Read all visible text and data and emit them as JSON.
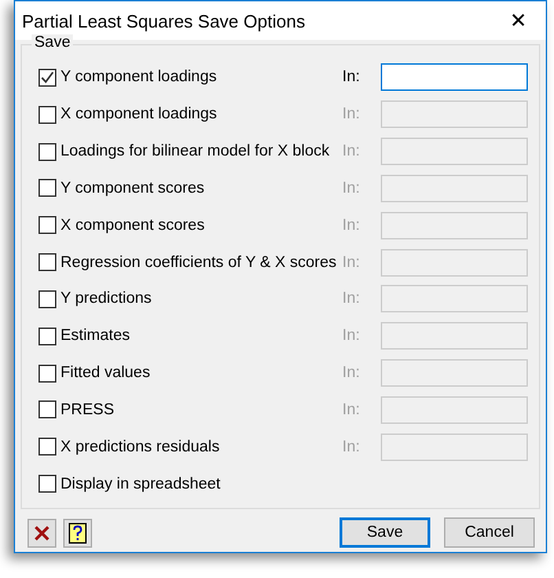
{
  "window": {
    "title": "Partial Least Squares Save Options",
    "close": "✕"
  },
  "group": {
    "title": "Save"
  },
  "rows": [
    {
      "kind": "field",
      "label": "Y component loadings",
      "checked": true,
      "in_label": "In:",
      "disabled": false
    },
    {
      "kind": "field",
      "label": "X component loadings",
      "checked": false,
      "in_label": "In:",
      "disabled": true
    },
    {
      "kind": "field",
      "label": "Loadings for bilinear model for X block",
      "checked": false,
      "in_label": "In:",
      "disabled": true
    },
    {
      "kind": "field",
      "label": "Y component scores",
      "checked": false,
      "in_label": "In:",
      "disabled": true
    },
    {
      "kind": "field",
      "label": "X component scores",
      "checked": false,
      "in_label": "In:",
      "disabled": true
    },
    {
      "kind": "field",
      "label": "Regression coefficients of Y & X scores",
      "checked": false,
      "in_label": "In:",
      "disabled": true
    },
    {
      "kind": "field",
      "label": "Y predictions",
      "checked": false,
      "in_label": "In:",
      "disabled": true
    },
    {
      "kind": "field",
      "label": "Estimates",
      "checked": false,
      "in_label": "In:",
      "disabled": true
    },
    {
      "kind": "field",
      "label": "Fitted values",
      "checked": false,
      "in_label": "In:",
      "disabled": true
    },
    {
      "kind": "field",
      "label": "PRESS",
      "checked": false,
      "in_label": "In:",
      "disabled": true
    },
    {
      "kind": "field",
      "label": "X predictions residuals",
      "checked": false,
      "in_label": "In:",
      "disabled": true
    },
    {
      "kind": "plain",
      "label": "Display in spreadsheet",
      "checked": false
    }
  ],
  "buttons": [
    {
      "label": "Save",
      "default": true
    },
    {
      "label": "Cancel",
      "default": false
    }
  ]
}
